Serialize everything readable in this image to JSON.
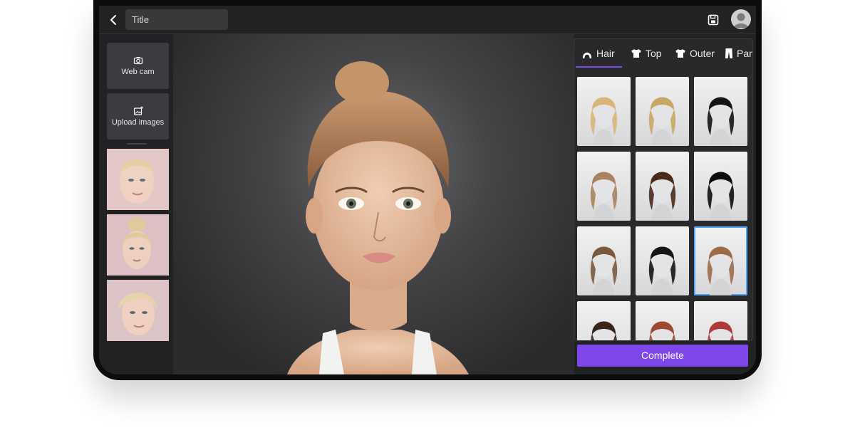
{
  "header": {
    "title_value": "Title"
  },
  "sidebar": {
    "webcam_label": "Web cam",
    "upload_label": "Upload images",
    "photos": [
      "photo-1",
      "photo-2",
      "photo-3"
    ]
  },
  "tabs": [
    {
      "label": "Hair",
      "icon": "hair-icon",
      "active": true
    },
    {
      "label": "Top",
      "icon": "tshirt-icon",
      "active": false
    },
    {
      "label": "Outer",
      "icon": "tshirt-icon",
      "active": false
    },
    {
      "label": "Pan",
      "icon": "pants-icon",
      "active": false
    }
  ],
  "hair_items": [
    {
      "style": "long-blonde",
      "color": "#d9b57a"
    },
    {
      "style": "short-blonde",
      "color": "#c8a765"
    },
    {
      "style": "black-bangs-buns",
      "color": "#141414"
    },
    {
      "style": "braids",
      "color": "#a8835e"
    },
    {
      "style": "curly-brown",
      "color": "#4a2a1a"
    },
    {
      "style": "black-bob",
      "color": "#0d0d0d"
    },
    {
      "style": "spiky",
      "color": "#7a5a3d"
    },
    {
      "style": "black-messy",
      "color": "#151515"
    },
    {
      "style": "brown-shaggy-selected",
      "color": "#9c6b48"
    },
    {
      "style": "dark-brown",
      "color": "#3a2418"
    },
    {
      "style": "auburn",
      "color": "#9e4a2e"
    },
    {
      "style": "red-long",
      "color": "#b03a38"
    }
  ],
  "selected_index": 8,
  "complete_label": "Complete",
  "colors": {
    "accent": "#7d47ea",
    "selection": "#4ea6ff"
  }
}
